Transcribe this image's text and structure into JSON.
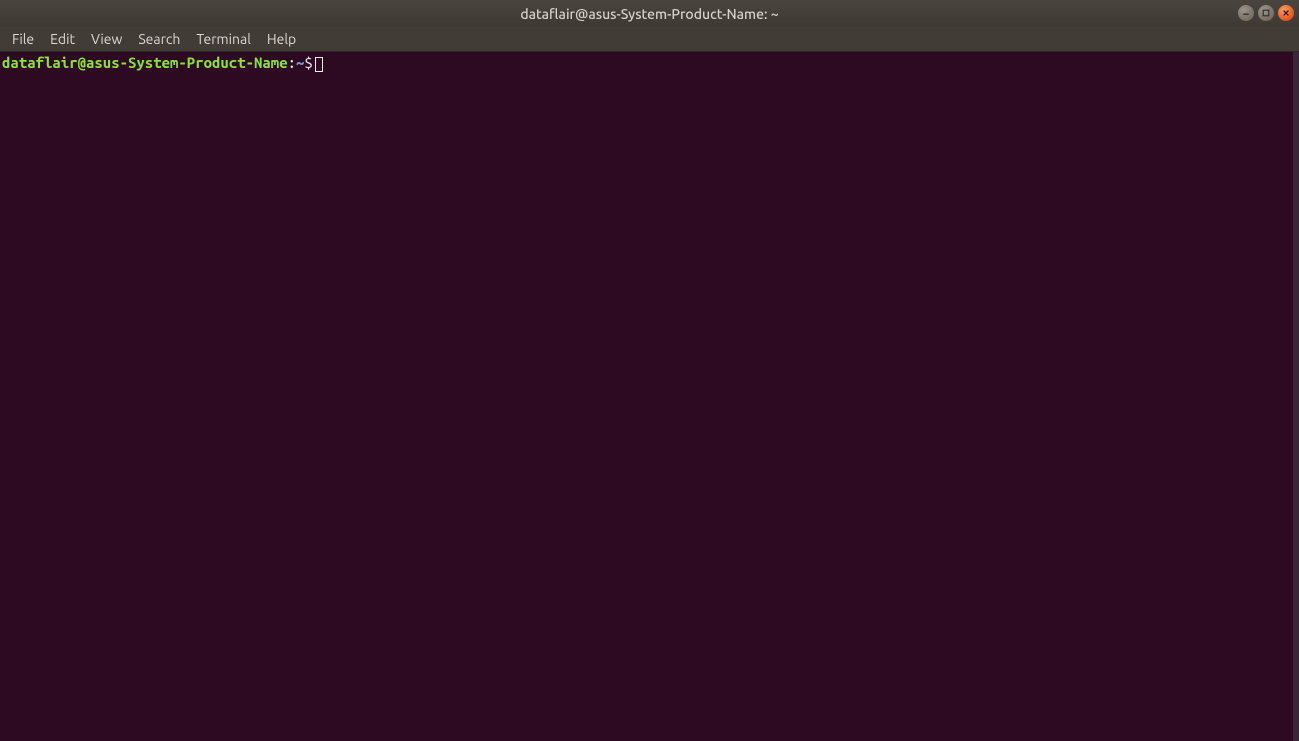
{
  "titlebar": {
    "title": "dataflair@asus-System-Product-Name: ~"
  },
  "menubar": {
    "items": [
      {
        "label": "File"
      },
      {
        "label": "Edit"
      },
      {
        "label": "View"
      },
      {
        "label": "Search"
      },
      {
        "label": "Terminal"
      },
      {
        "label": "Help"
      }
    ]
  },
  "terminal": {
    "prompt": {
      "user_host": "dataflair@asus-System-Product-Name",
      "colon": ":",
      "path": "~",
      "dollar": "$"
    },
    "command": ""
  },
  "colors": {
    "terminal_bg": "#2d0922",
    "prompt_green": "#8ae234",
    "prompt_blue": "#729fcf",
    "text_default": "#eeeeec",
    "titlebar_bg": "#3e3933",
    "menubar_bg": "#413c36",
    "close_btn": "#df4a16"
  }
}
